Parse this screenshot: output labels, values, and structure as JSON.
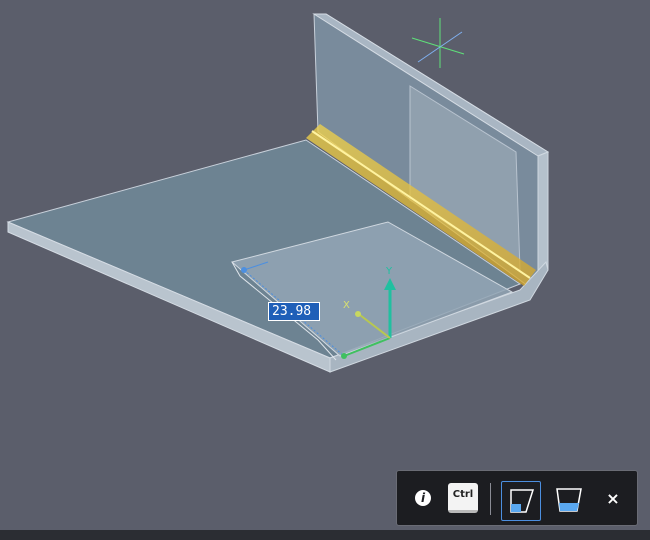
{
  "viewport": {
    "dimension_value": "23.98",
    "axis_labels": {
      "x": "X",
      "y": "Y"
    }
  },
  "toolbar": {
    "info_glyph": "i",
    "ctrl_label": "Ctrl",
    "close_glyph": "×",
    "icons": [
      "info-icon",
      "ctrl-key-icon",
      "flange-mode-1-icon",
      "flange-mode-2-icon",
      "close-icon"
    ]
  },
  "colors": {
    "background": "#5b5e6b",
    "highlight_edge": "#f0c030",
    "toolbar_bg": "#1c1d21",
    "active_border": "#4c8fe0"
  }
}
